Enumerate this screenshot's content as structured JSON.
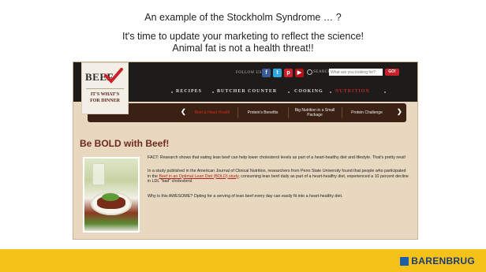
{
  "slide": {
    "title_line1": "An example of the Stockholm Syndrome … ?",
    "title_line2": "It's time to update your marketing to reflect the science!",
    "title_line3": "Animal fat is not a health threat!!"
  },
  "site": {
    "logo": {
      "brand": "BEEF",
      "tagline_1": "IT'S WHAT'S",
      "tagline_2": "FOR DINNER"
    },
    "header": {
      "follow_label": "FOLLOW US:",
      "search_label": "SEARCH",
      "search_placeholder": "What are you looking for?",
      "search_button": "GO!"
    },
    "nav": [
      "RECIPES",
      "BUTCHER COUNTER",
      "COOKING",
      "NUTRITION"
    ],
    "active_nav": "NUTRITION",
    "subnav": {
      "tabs": [
        "Beef & Heart Health",
        "Protein's Benefits",
        "Big Nutrition in a Small Package",
        "Protein Challenge"
      ],
      "prev": "❮",
      "next": "❯"
    },
    "article": {
      "heading": "Be BOLD with Beef!",
      "p1": "FACT: Research shows that eating lean beef can help lower cholesterol levels as part of a heart-healthy diet and lifestyle. That's pretty neat!",
      "p2_before": "In a study published in the American Journal of Clinical Nutrition, researchers from Penn State University found that people who participated in the ",
      "p2_link": "Beef in an Optimal Lean Diet (BOLD) study",
      "p2_after": ", consuming lean beef daily as part of a heart-healthy diet, experienced a 10 percent decline in LDL \"bad\" cholesterol.",
      "p3": "Why is this AWESOME? Opting for a serving of lean beef every day can easily fit into a heart-healthy diet."
    }
  },
  "footer": {
    "brand": "BARENBRUG"
  },
  "colors": {
    "footer_bg": "#f5c21a",
    "brand_red": "#c8232c",
    "heading_brown": "#6e2a1d"
  }
}
